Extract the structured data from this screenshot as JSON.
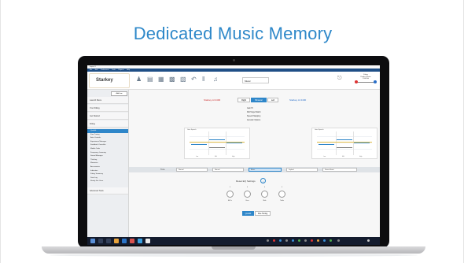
{
  "slide": {
    "title": "Dedicated Music Memory"
  },
  "app": {
    "brand": "Starkey",
    "title_text": "Inspire X",
    "menu": [
      "File",
      "Edit",
      "Preferences",
      "Tools",
      "Reports",
      "Help"
    ],
    "program_dropdown": "Music",
    "product_status": {
      "line1": "Fitting",
      "line2": "Product Status",
      "line3": "R Hi Mid"
    },
    "sidebar": {
      "add_button": "Add Item",
      "sections": [
        {
          "label": "Launch Menu"
        },
        {
          "label": "Your Fitting"
        },
        {
          "label": "Get Started"
        },
        {
          "label": "Fitting",
          "active": true
        }
      ],
      "items": [
        {
          "label": "Quickfit",
          "active": true
        },
        {
          "label": "Fine Tuning"
        },
        {
          "label": "Auto Controls"
        },
        {
          "label": "Experience Manager"
        },
        {
          "label": "Feedback Canceller"
        },
        {
          "label": "Mobile Tools"
        },
        {
          "label": "Frequency Lowering"
        },
        {
          "label": "Sound Manager"
        },
        {
          "label": "Thinking"
        },
        {
          "label": "Memories"
        },
        {
          "label": "Accessories"
        },
        {
          "label": "Indicators"
        },
        {
          "label": "Fitting Summary"
        },
        {
          "label": "Data Log"
        },
        {
          "label": "Ready Set. Hear"
        }
      ],
      "footer": "Advanced Tools"
    },
    "ear_bar": {
      "left_ear": "Starkey AI 2400",
      "right_ear": "Starkey AI 2400",
      "buttons": [
        {
          "label": "Right",
          "active": false
        },
        {
          "label": "Binaural",
          "active": true
        },
        {
          "label": "Left",
          "active": false
        }
      ]
    },
    "options": [
      "Gain Ht",
      "Mid Target Match",
      "Speech Mapping",
      "Acoustic Options"
    ],
    "left_chart_header": "Gain Speech",
    "right_chart_header": "Gain Speech",
    "chart_axis_labels": [
      "Low",
      "Mid",
      "High"
    ],
    "controls": {
      "tone_label": "Tone",
      "dropdowns": [
        {
          "label": "Normal",
          "active": false
        },
        {
          "label": "Normal",
          "active": false
        },
        {
          "label": "Music",
          "active": true
        },
        {
          "label": "Drybed",
          "active": false
        },
        {
          "label": "Stereo Boost",
          "active": false
        }
      ]
    },
    "reset_label": "Reset EQ Settings",
    "info_icon_text": "i",
    "knobs": [
      {
        "label": "All Dx",
        "value": "0"
      },
      {
        "label": "Bass",
        "value": "0"
      },
      {
        "label": "Mids",
        "value": "0"
      },
      {
        "label": "Treble",
        "value": "0"
      }
    ],
    "bottom_buttons": [
      {
        "label": "Quickfit",
        "active": true
      },
      {
        "label": "Fine Tuning",
        "active": false
      }
    ]
  },
  "colors": {
    "title_blue": "#2e88c9",
    "accent": "#2e86c9",
    "taskbar": "#141c2e"
  }
}
